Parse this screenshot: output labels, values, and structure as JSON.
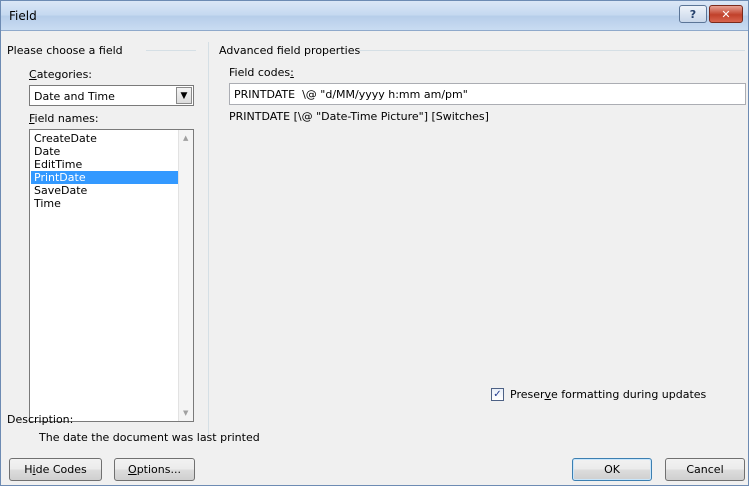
{
  "window": {
    "title": "Field",
    "help_glyph": "?",
    "close_glyph": "✕"
  },
  "left_panel": {
    "group_title": "Please choose a field",
    "categories_label": "Categories:",
    "categories_selected": "Date and Time",
    "field_names_label": "Field names:",
    "field_names": [
      {
        "label": "CreateDate",
        "selected": false
      },
      {
        "label": "Date",
        "selected": false
      },
      {
        "label": "EditTime",
        "selected": false
      },
      {
        "label": "PrintDate",
        "selected": true
      },
      {
        "label": "SaveDate",
        "selected": false
      },
      {
        "label": "Time",
        "selected": false
      }
    ]
  },
  "right_panel": {
    "group_title": "Advanced field properties",
    "field_codes_label": "Field codes:",
    "field_codes_value": "PRINTDATE  \\@ \"d/MM/yyyy h:mm am/pm\"",
    "syntax_hint": "PRINTDATE [\\@ \"Date-Time Picture\"] [Switches]",
    "preserve_formatting_label": "Preserve formatting during updates",
    "preserve_formatting_checked": true
  },
  "description": {
    "label": "Description:",
    "text": "The date the document was last printed"
  },
  "buttons": {
    "hide_codes": "Hide Codes",
    "options": "Options...",
    "ok": "OK",
    "cancel": "Cancel"
  },
  "icons": {
    "combo_arrow": "chevron-down-icon",
    "scroll_up": "scroll-up-arrow-icon",
    "scroll_down": "scroll-down-arrow-icon",
    "checkmark": "checkmark-icon"
  }
}
